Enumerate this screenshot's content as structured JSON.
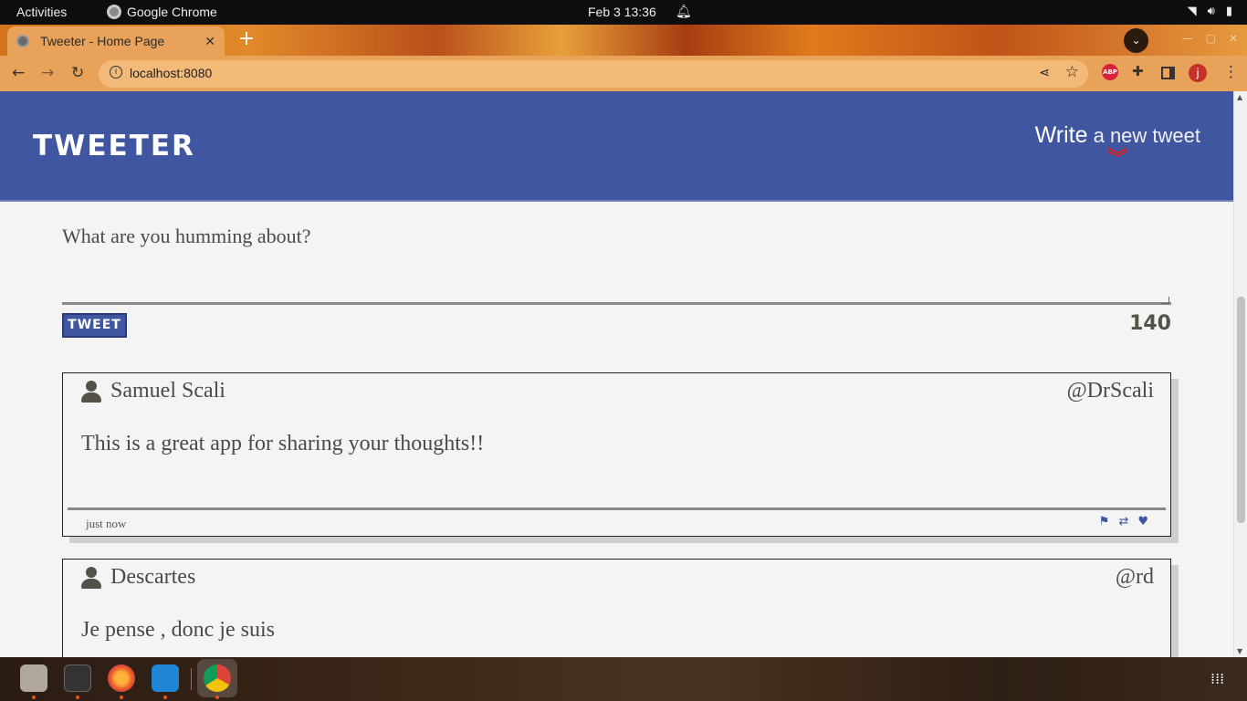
{
  "system": {
    "activities": "Activities",
    "app_name": "Google Chrome",
    "clock": "Feb 3  13:36"
  },
  "browser": {
    "tab_title": "Tweeter - Home Page",
    "url": "localhost:8080",
    "profile_initial": "j",
    "abp_label": "ABP"
  },
  "page": {
    "logo": "Tweeter",
    "write_strong": "Write",
    "write_rest": " a new tweet",
    "composer_placeholder": "What are you humming about?",
    "tweet_button": "Tweet",
    "counter": "140"
  },
  "tweets": [
    {
      "name": "Samuel Scali",
      "handle": "@DrScali",
      "text": "This is a great app for sharing your thoughts!!",
      "time": "just now"
    },
    {
      "name": "Descartes",
      "handle": "@rd",
      "text": "Je pense , donc je suis"
    }
  ],
  "colors": {
    "header_blue": "#4056a1",
    "accent_red": "#c0272d",
    "text_gray": "#545149"
  },
  "icons": {
    "flag": "flag-icon",
    "retweet": "retweet-icon",
    "heart": "heart-icon",
    "user": "user-icon",
    "chevron": "double-chevron-down-icon"
  }
}
